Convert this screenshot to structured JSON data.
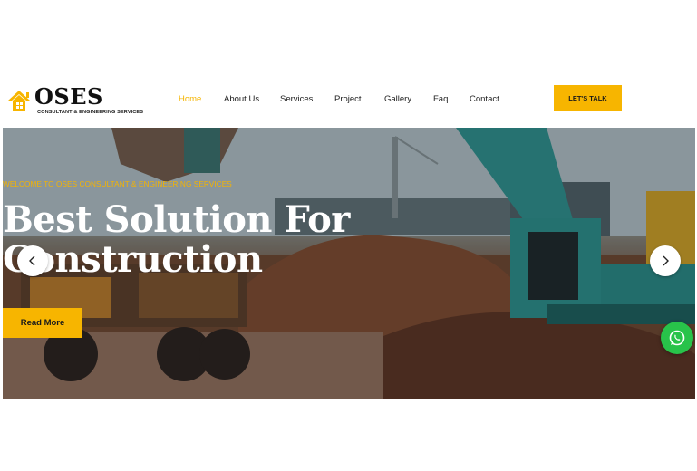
{
  "brand": {
    "name": "OSES",
    "tagline": "CONSULTANT & ENGINEERING SERVICES",
    "accent_color": "#f7b500",
    "icon": "house-logo-icon"
  },
  "nav": {
    "items": [
      {
        "label": "Home",
        "active": true
      },
      {
        "label": "About Us",
        "active": false
      },
      {
        "label": "Services",
        "active": false
      },
      {
        "label": "Project",
        "active": false
      },
      {
        "label": "Gallery",
        "active": false
      },
      {
        "label": "Faq",
        "active": false
      },
      {
        "label": "Contact",
        "active": false
      }
    ],
    "cta_label": "LET'S TALK"
  },
  "hero": {
    "eyebrow": "WELCOME TO OSES CONSULTANT & ENGINEERING SERVICES",
    "headline_line1": "Best Solution For",
    "headline_line2": "Construction",
    "button_label": "Read More",
    "image": "construction-site-photo",
    "prev_icon": "chevron-left-icon",
    "next_icon": "chevron-right-icon"
  },
  "floating": {
    "icon": "whatsapp-icon",
    "color": "#28c34a"
  }
}
